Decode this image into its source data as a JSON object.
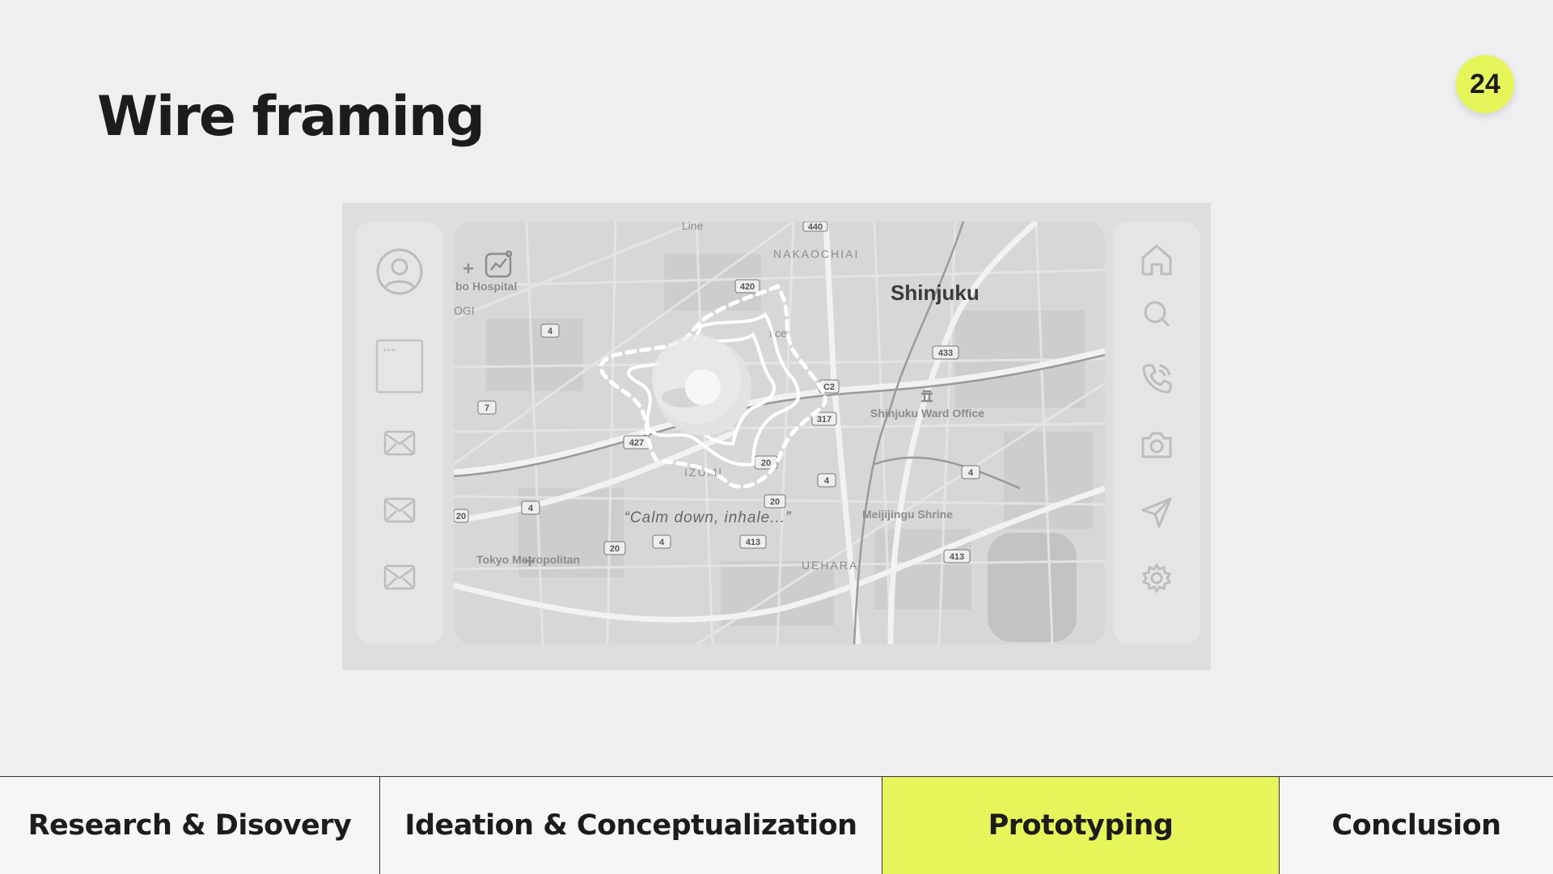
{
  "slide": {
    "title": "Wire framing",
    "page_number": "24"
  },
  "map": {
    "labels": {
      "line": "Line",
      "nakaochiai": "NAKAOCHIAI",
      "shinjuku": "Shinjuku",
      "hospital": "bo Hospital",
      "ogi": "OGI",
      "office": "fice",
      "ward_office": "Shinjuku Ward Office",
      "izumi": "IZUMI",
      "shrine": "Meijijingu Shrine",
      "tokyo": "Tokyo Metropolitan",
      "uehara": "UEHARA"
    },
    "road_markers": {
      "r440": "440",
      "r420": "420",
      "r4a": "4",
      "r433": "433",
      "r7": "7",
      "rc2": "C2",
      "r317": "317",
      "r427": "427",
      "r20a": "20",
      "r4b": "4",
      "r4c": "4",
      "r4d": "4",
      "r20b": "20",
      "r20c": "20",
      "r20d": "20",
      "r4e": "4",
      "r413a": "413",
      "r413b": "413"
    },
    "caption": "“Calm down, inhale...”"
  },
  "left_panel_icons": [
    "user-icon",
    "card-icon",
    "mail-icon",
    "mail-icon",
    "mail-icon"
  ],
  "right_panel_icons": [
    "home-icon",
    "search-icon",
    "phone-icon",
    "camera-icon",
    "send-icon",
    "gear-icon"
  ],
  "tabs": [
    {
      "label": "Research & Disovery",
      "active": false
    },
    {
      "label": "Ideation & Conceptualization",
      "active": false
    },
    {
      "label": "Prototyping",
      "active": true
    },
    {
      "label": "Conclusion",
      "active": false
    }
  ],
  "colors": {
    "accent": "#e6f55a",
    "background": "#efeff1",
    "text": "#1c1c1c"
  }
}
